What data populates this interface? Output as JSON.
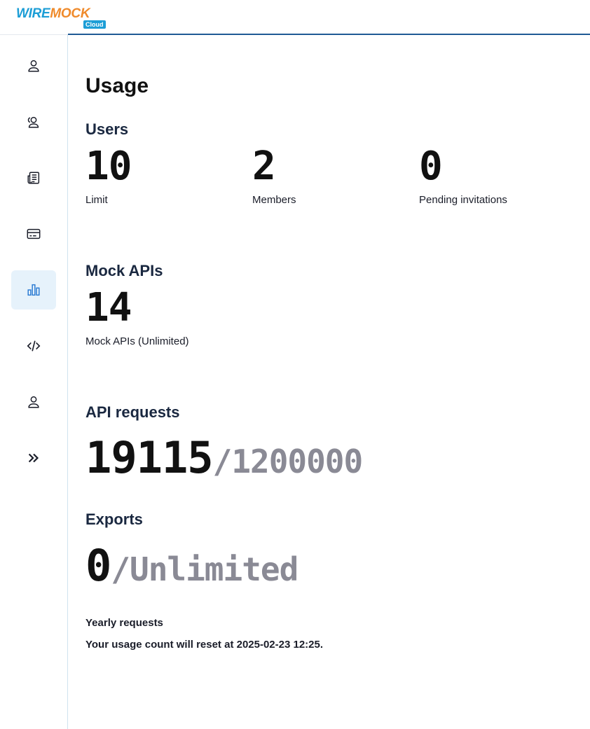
{
  "brand": {
    "word_a": "WIRE",
    "word_b": "MOCK",
    "badge": "Cloud"
  },
  "sidebar": {
    "items": [
      {
        "icon": "user-icon",
        "active": false
      },
      {
        "icon": "team-icon",
        "active": false
      },
      {
        "icon": "newspaper-icon",
        "active": false
      },
      {
        "icon": "billing-card-icon",
        "active": false
      },
      {
        "icon": "bar-chart-icon",
        "active": true
      },
      {
        "icon": "code-icon",
        "active": false
      },
      {
        "icon": "account-icon",
        "active": false
      },
      {
        "icon": "expand-icon",
        "active": false
      }
    ]
  },
  "page": {
    "title": "Usage"
  },
  "users": {
    "title": "Users",
    "stats": [
      {
        "value": "10",
        "label": "Limit"
      },
      {
        "value": "2",
        "label": "Members"
      },
      {
        "value": "0",
        "label": "Pending invitations"
      }
    ]
  },
  "mock_apis": {
    "title": "Mock APIs",
    "value": "14",
    "label": "Mock APIs (Unlimited)"
  },
  "api_requests": {
    "title": "API requests",
    "value": "19115",
    "suffix": "/1200000"
  },
  "exports": {
    "title": "Exports",
    "value": "0",
    "suffix": "/Unlimited"
  },
  "footer": {
    "period": "Yearly requests",
    "reset_text": "Your usage count will reset at 2025-02-23 12:25."
  },
  "colors": {
    "accent": "#1f5a95",
    "active_bg": "#e6f2fb",
    "active_icon": "#2b7bd3",
    "muted": "#8a8a95"
  }
}
